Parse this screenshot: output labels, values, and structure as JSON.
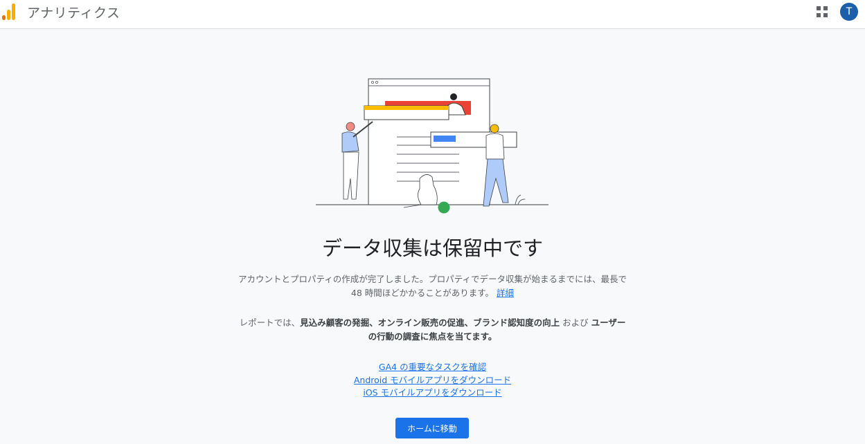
{
  "header": {
    "app_title": "アナリティクス",
    "avatar_initial": "T"
  },
  "main": {
    "heading": "データ収集は保留中です",
    "intro_text": "アカウントとプロパティの作成が完了しました。プロパティでデータ収集が始まるまでには、最長で 48 時間ほどかかることがあります。",
    "details_link": "詳細",
    "report_prefix": "レポートでは、",
    "report_focus_1": "見込み顧客の発掘",
    "sep_1": "、",
    "report_focus_2": "オンライン販売の促進",
    "sep_2": "、",
    "report_focus_3": "ブランド認知度の向上",
    "report_and": " および ",
    "report_focus_4": "ユーザーの行動の調査",
    "report_suffix": "に焦点を当てます。",
    "links": [
      "GA4 の重要なタスクを確認",
      "Android モバイルアプリをダウンロード",
      "iOS モバイルアプリをダウンロード"
    ],
    "home_button": "ホームに移動"
  },
  "colors": {
    "primary_blue": "#1a73e8",
    "logo_orange": "#f9ab00",
    "logo_dark_orange": "#e37400",
    "accent_red": "#ea4335",
    "accent_yellow": "#fbbc04",
    "accent_green": "#34a853",
    "avatar_bg": "#1a5fa8"
  }
}
